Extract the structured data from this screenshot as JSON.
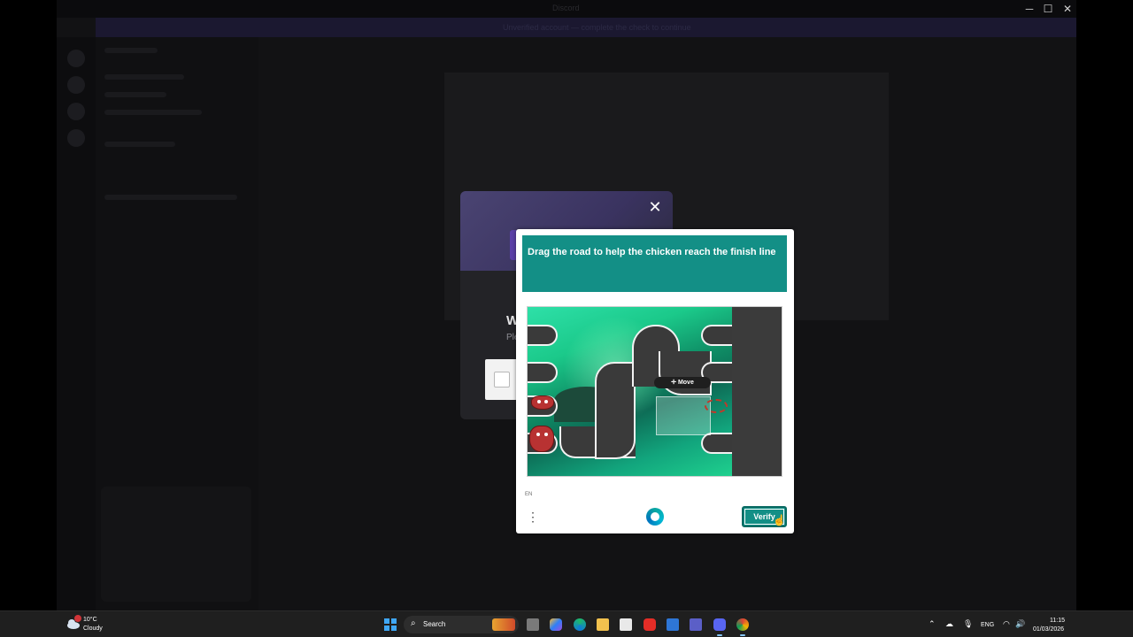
{
  "window": {
    "title": "Discord",
    "banner_text": "Unverified account — complete the check to continue",
    "modal": {
      "heading": "W",
      "subtext": "Ple"
    }
  },
  "captcha": {
    "prompt": "Drag the road to help the chicken reach the finish line",
    "move_label": "Move",
    "language": "EN",
    "verify_label": "Verify",
    "menu_glyph": "⋮"
  },
  "taskbar": {
    "weather": {
      "temperature": "10°C",
      "condition": "Cloudy"
    },
    "search_label": "Search",
    "language": "ENG",
    "time": "11:15",
    "date": "01/03/2026",
    "pinned_apps": [
      "file-explorer-icon",
      "copilot-icon",
      "edge-icon",
      "folder-icon",
      "store-icon",
      "youtube-icon",
      "mail-icon",
      "teams-icon",
      "discord-icon",
      "chrome-icon"
    ]
  },
  "colors": {
    "captcha_teal": "#138f86",
    "taskbar_bg": "#1f1f1f",
    "windows_blue": "#3fa7f5"
  }
}
